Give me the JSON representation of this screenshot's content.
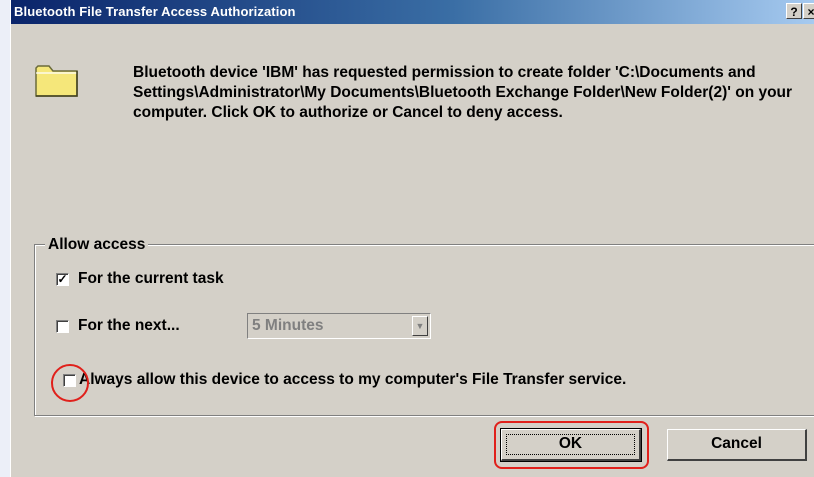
{
  "window": {
    "title": "Bluetooth File Transfer Access Authorization",
    "help_button": "?",
    "close_button": "×"
  },
  "icon": "folder-icon",
  "message": "Bluetooth device 'IBM' has requested permission to create folder 'C:\\Documents and Settings\\Administrator\\My Documents\\Bluetooth Exchange Folder\\New Folder(2)' on your computer.  Click OK to authorize or Cancel to deny access.",
  "access_group": {
    "legend": "Allow access",
    "current_task": {
      "label": "For the current task",
      "checked": true
    },
    "next": {
      "label": "For the next...",
      "checked": false
    },
    "duration_select": {
      "value": "5 Minutes",
      "enabled": false
    },
    "always_allow": {
      "label": "Always allow this device to access to my computer's File Transfer service.",
      "checked": false
    }
  },
  "buttons": {
    "ok": "OK",
    "cancel": "Cancel"
  },
  "annotation_color": "#E0201B"
}
